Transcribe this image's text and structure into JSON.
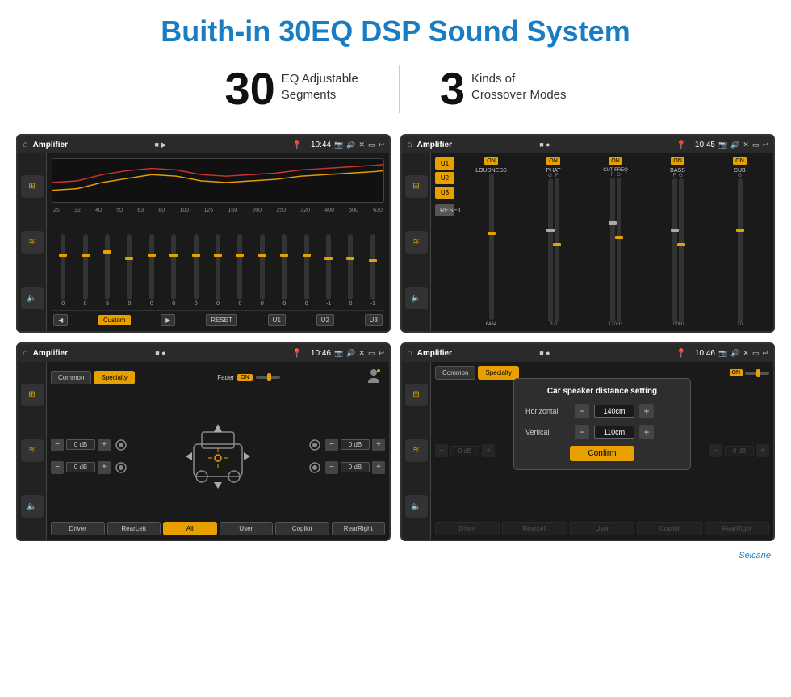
{
  "page": {
    "title": "Buith-in 30EQ DSP Sound System",
    "stats": [
      {
        "number": "30",
        "label": "EQ Adjustable\nSegments"
      },
      {
        "number": "3",
        "label": "Kinds of\nCrossover Modes"
      }
    ]
  },
  "screen1": {
    "title": "Amplifier",
    "time": "10:44",
    "eq_freqs": [
      "25",
      "32",
      "40",
      "50",
      "63",
      "80",
      "100",
      "125",
      "160",
      "200",
      "250",
      "320",
      "400",
      "500",
      "630"
    ],
    "buttons": {
      "prev": "◀",
      "custom": "Custom",
      "play": "▶",
      "reset": "RESET",
      "u1": "U1",
      "u2": "U2",
      "u3": "U3"
    }
  },
  "screen2": {
    "title": "Amplifier",
    "time": "10:45",
    "presets": [
      "U1",
      "U2",
      "U3"
    ],
    "channels": [
      {
        "label": "LOUDNESS",
        "on": true
      },
      {
        "label": "PHAT",
        "on": true
      },
      {
        "label": "CUT FREQ",
        "on": true
      },
      {
        "label": "BASS",
        "on": true
      },
      {
        "label": "SUB",
        "on": true
      }
    ],
    "reset_label": "RESET"
  },
  "screen3": {
    "title": "Amplifier",
    "time": "10:46",
    "tabs": [
      "Common",
      "Specialty"
    ],
    "fader_label": "Fader",
    "fader_on": "ON",
    "speakers": {
      "front_left": "0 dB",
      "front_right": "0 dB",
      "rear_left": "0 dB",
      "rear_right": "0 dB"
    },
    "bottom_btns": [
      "Driver",
      "RearLeft",
      "All",
      "User",
      "Copilot",
      "RearRight"
    ]
  },
  "screen4": {
    "title": "Amplifier",
    "time": "10:46",
    "tabs": [
      "Common",
      "Specialty"
    ],
    "dialog": {
      "title": "Car speaker distance setting",
      "horizontal_label": "Horizontal",
      "horizontal_value": "140cm",
      "vertical_label": "Vertical",
      "vertical_value": "110cm",
      "confirm_label": "Confirm"
    },
    "bottom_btns": [
      "Driver",
      "RearLeft",
      "User",
      "Copilot",
      "RearRight"
    ]
  },
  "watermark": "Seicane"
}
